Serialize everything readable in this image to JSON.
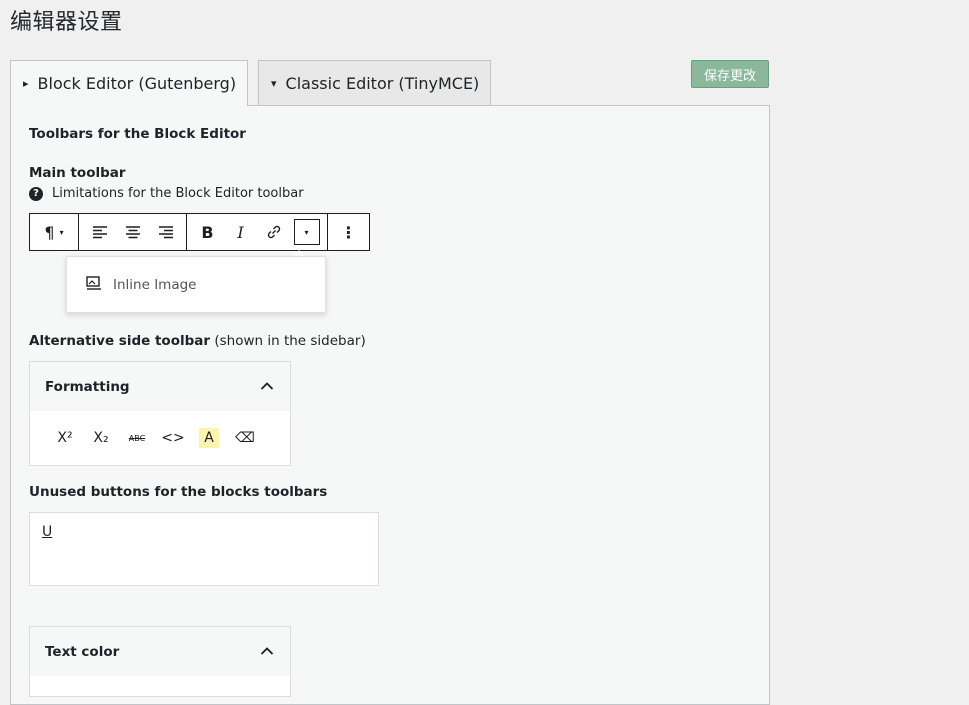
{
  "page": {
    "title": "编辑器设置"
  },
  "tabs": [
    {
      "label": "Block Editor (Gutenberg)",
      "arrow": "▸"
    },
    {
      "label": "Classic Editor (TinyMCE)",
      "arrow": "▾"
    }
  ],
  "save_button": "保存更改",
  "sections": {
    "toolbars_heading": "Toolbars for the Block Editor",
    "main_toolbar": "Main toolbar",
    "limitations_link": "Limitations for the Block Editor toolbar",
    "alt_side_toolbar_bold": "Alternative side toolbar",
    "alt_side_toolbar_note": " (shown in the sidebar)",
    "unused_heading": "Unused buttons for the blocks toolbars"
  },
  "toolbar": {
    "paragraph": "¶",
    "align_left": "≡",
    "align_center": "≡",
    "align_right": "≡",
    "bold": "B",
    "italic": "I",
    "link": "🔗",
    "more": "⋮"
  },
  "dropdown": {
    "item": "Inline Image"
  },
  "formatting_card": {
    "title": "Formatting",
    "buttons": [
      "X²",
      "X₂",
      "ABC",
      "<>",
      "A",
      "⌫"
    ]
  },
  "unused_buttons": [
    "U"
  ],
  "text_color_card": {
    "title": "Text color"
  }
}
